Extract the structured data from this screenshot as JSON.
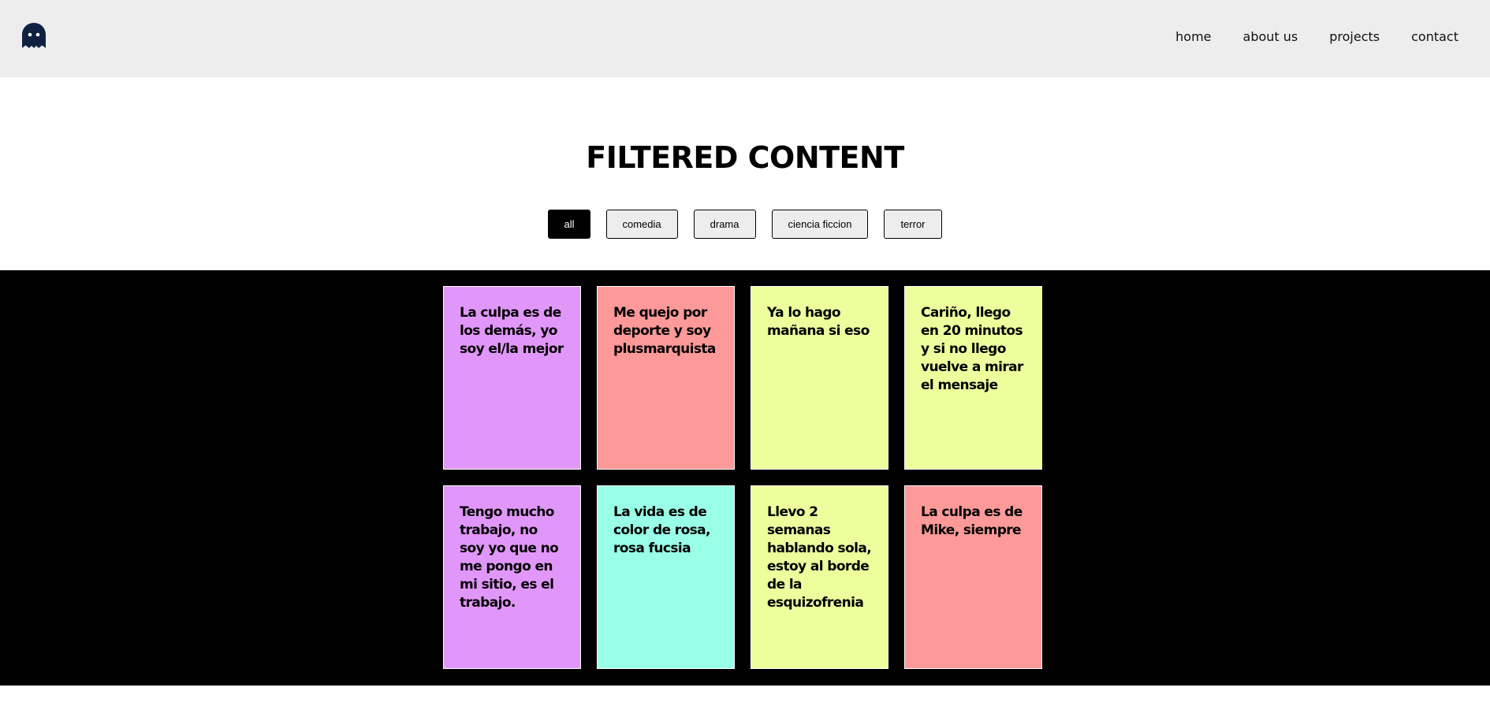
{
  "header": {
    "logo_icon": "ghost-icon",
    "nav": [
      {
        "label": "home"
      },
      {
        "label": "about us"
      },
      {
        "label": "projects"
      },
      {
        "label": "contact"
      }
    ]
  },
  "main": {
    "title": "FILTERED CONTENT",
    "filters": [
      {
        "label": "all",
        "active": true
      },
      {
        "label": "comedia",
        "active": false
      },
      {
        "label": "drama",
        "active": false
      },
      {
        "label": "ciencia ficcion",
        "active": false
      },
      {
        "label": "terror",
        "active": false
      }
    ],
    "cards": [
      {
        "text": "La culpa es de los demás, yo soy el/la mejor",
        "color": "#e197f9"
      },
      {
        "text": "Me quejo por deporte y soy plusmarquista",
        "color": "#fe9999"
      },
      {
        "text": "Ya lo hago mañana si eso",
        "color": "#edfe9d"
      },
      {
        "text": "Cariño, llego en 20 minutos y si no llego vuelve a mirar el mensaje",
        "color": "#edfe9d"
      },
      {
        "text": "Tengo mucho trabajo, no soy yo que no me pongo en mi sitio, es el trabajo.",
        "color": "#e197f9"
      },
      {
        "text": "La vida es de color de rosa, rosa fucsia",
        "color": "#99ffe7"
      },
      {
        "text": "Llevo 2 semanas hablando sola, estoy al borde de la esquizofrenia",
        "color": "#edfe9d"
      },
      {
        "text": "La culpa es de Mike, siempre",
        "color": "#fe9999"
      }
    ]
  },
  "colors": {
    "header_bg": "#ededed",
    "gallery_bg": "#000000",
    "logo": "#0f2140",
    "active_filter_bg": "#000000",
    "filter_bg": "#ededed"
  }
}
